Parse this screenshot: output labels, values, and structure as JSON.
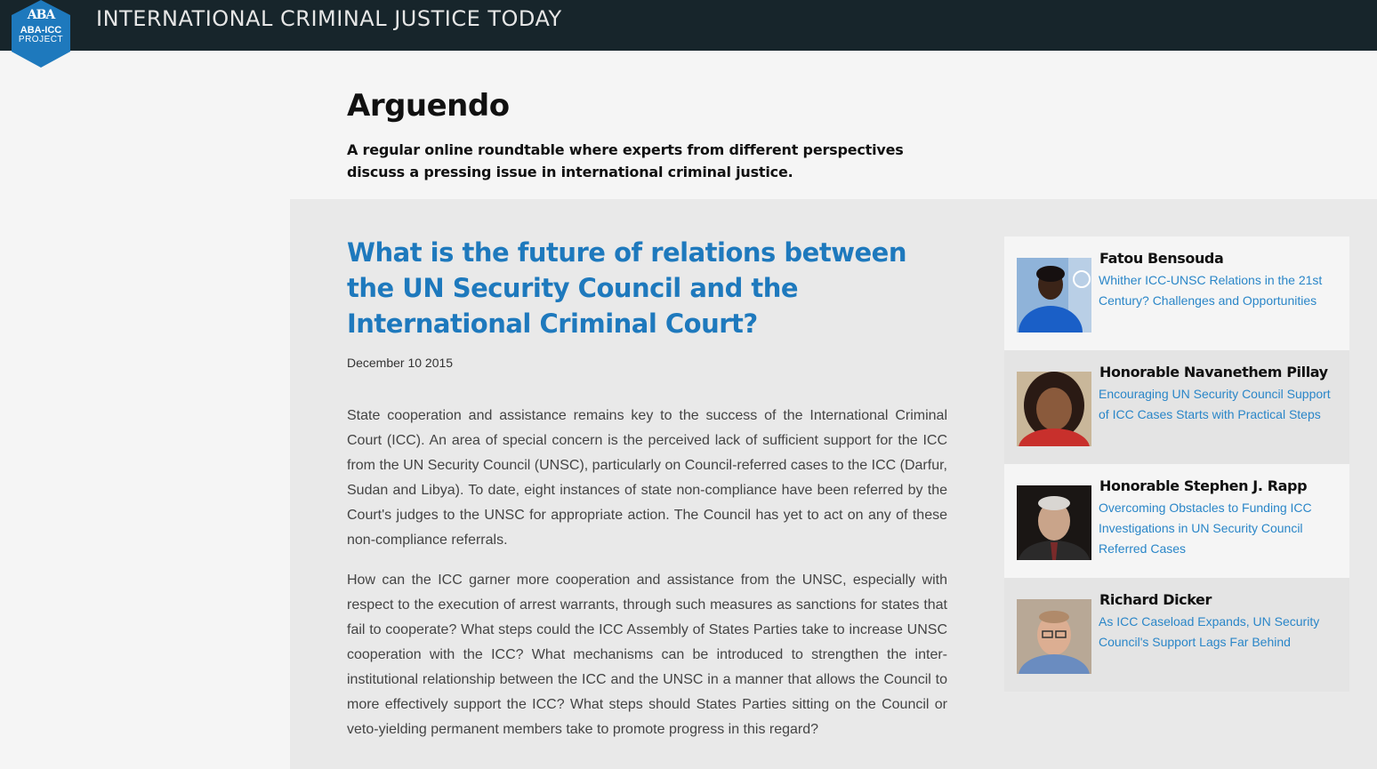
{
  "header": {
    "site_title": "INTERNATIONAL CRIMINAL JUSTICE TODAY",
    "logo": {
      "mark": "ABA",
      "line1": "ABA-ICC",
      "line2": "PROJECT",
      "color": "#1e79bd"
    }
  },
  "hero": {
    "title": "Arguendo",
    "subtitle": "A regular online roundtable where experts from different perspectives discuss a pressing issue in international criminal justice."
  },
  "article": {
    "title": "What is the future of relations between the UN Security Council and the International Criminal Court?",
    "date": "December 10 2015",
    "paragraphs": [
      "State cooperation and assistance remains key to the success of the International Criminal Court (ICC). An area of special concern is the perceived lack of sufficient support for the ICC from the UN Security Council (UNSC), particularly on Council-referred cases to the ICC (Darfur, Sudan and Libya). To date, eight instances of state non-compliance have been referred by the Court's judges to the UNSC for appropriate action. The Council has yet to act on any of these non-compliance referrals.",
      "How can the ICC garner more cooperation and assistance from the UNSC, especially with respect to the execution of arrest warrants, through such measures as sanctions for states that fail to cooperate? What steps could the ICC Assembly of States Parties take to increase UNSC cooperation with the ICC? What mechanisms can be introduced to strengthen the inter-institutional relationship between the ICC and the UNSC in a manner that allows the Council to more effectively support the ICC? What steps should States Parties sitting on the Council or veto-yielding permanent members take to promote progress in this regard?"
    ]
  },
  "contributors": [
    {
      "name": "Fatou Bensouda",
      "link": "Whither ICC-UNSC Relations in the 21st Century? Challenges and Opportunities"
    },
    {
      "name": "Honorable Navanethem Pillay",
      "link": "Encouraging UN Security Council Support of ICC Cases Starts with Practical Steps"
    },
    {
      "name": "Honorable Stephen J. Rapp",
      "link": "Overcoming Obstacles to Funding ICC Investigations in UN Security Council Referred Cases"
    },
    {
      "name": "Richard Dicker",
      "link": "As ICC Caseload Expands, UN Security Council's Support Lags Far Behind"
    }
  ],
  "colors": {
    "topbar": "#17252b",
    "accent": "#1e79bd",
    "link": "#2a86c8"
  }
}
